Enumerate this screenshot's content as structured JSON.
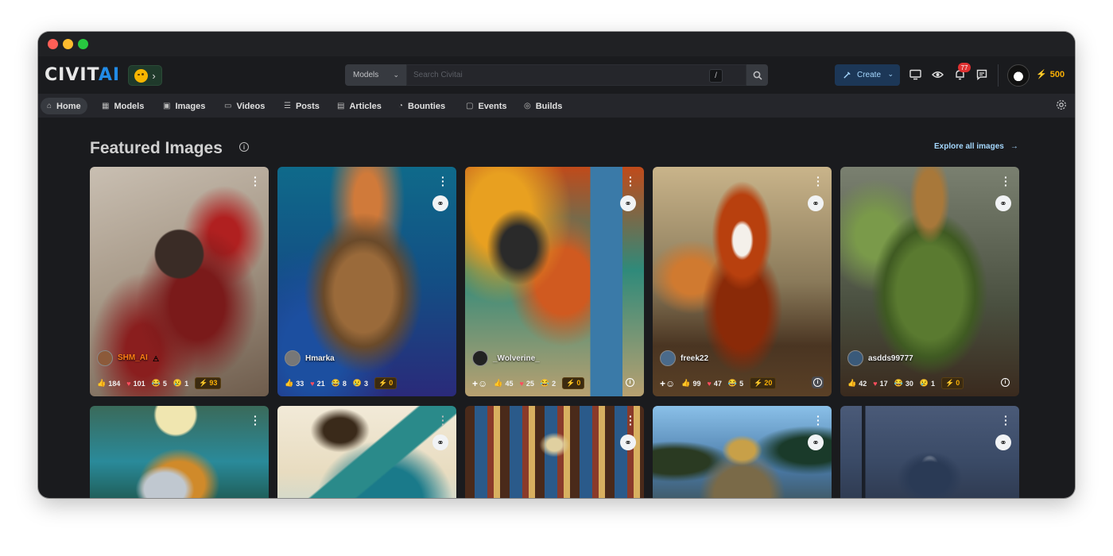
{
  "window": {
    "traffic_lights": [
      "close",
      "minimize",
      "maximize"
    ]
  },
  "header": {
    "logo_civit": "CIVIT",
    "logo_ai": "AI",
    "emoji_chevron": "›",
    "search_type": "Models",
    "search_placeholder": "Search Civitai",
    "search_shortcut": "/",
    "create_label": "Create",
    "notifications_count": "77",
    "buzz_amount": "500",
    "accent_color": "#228be6"
  },
  "nav": {
    "items": [
      {
        "label": "Home",
        "icon": "home-icon"
      },
      {
        "label": "Models",
        "icon": "grid-icon"
      },
      {
        "label": "Images",
        "icon": "photo-icon"
      },
      {
        "label": "Videos",
        "icon": "video-icon"
      },
      {
        "label": "Posts",
        "icon": "posts-icon"
      },
      {
        "label": "Articles",
        "icon": "article-icon"
      },
      {
        "label": "Bounties",
        "icon": "moneybag-icon"
      },
      {
        "label": "Events",
        "icon": "calendar-icon"
      },
      {
        "label": "Builds",
        "icon": "cpu-icon"
      }
    ]
  },
  "featured": {
    "title": "Featured Images",
    "explore_label": "Explore all images"
  },
  "cards": [
    {
      "user": "SHM_AI",
      "likes": "184",
      "hearts": "101",
      "laughs": "5",
      "cries": "1",
      "buzz": "93"
    },
    {
      "user": "Hmarka",
      "likes": "33",
      "hearts": "21",
      "laughs": "8",
      "cries": "3",
      "buzz": "0"
    },
    {
      "user": "_Wolverine_",
      "likes": "45",
      "hearts": "25",
      "laughs": "2",
      "cries": "",
      "buzz": "0"
    },
    {
      "user": "freek22",
      "likes": "99",
      "hearts": "47",
      "laughs": "5",
      "cries": "",
      "buzz": "20"
    },
    {
      "user": "asdds99777",
      "likes": "42",
      "hearts": "17",
      "laughs": "30",
      "cries": "1",
      "buzz": "0"
    }
  ]
}
